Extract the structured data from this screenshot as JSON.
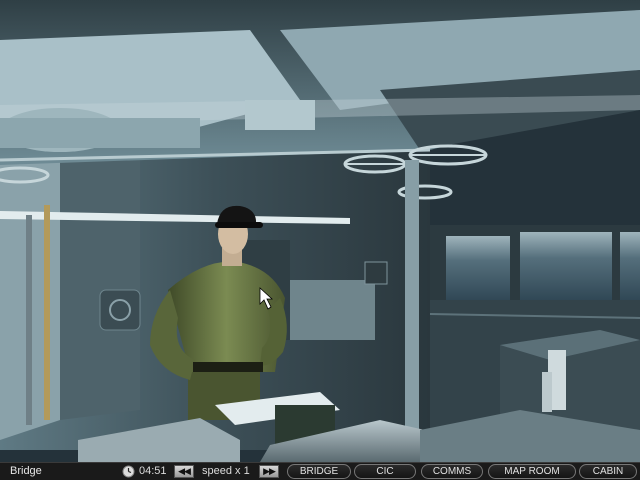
{
  "scene": {
    "location_name": "Bridge"
  },
  "statusbar": {
    "location": "Bridge",
    "time": "04:51",
    "speed_label": "speed x 1",
    "speed_down_icon": "rewind-icon",
    "speed_up_icon": "fast-forward-icon",
    "clock_icon": "clock-icon"
  },
  "nav": {
    "bridge": "BRIDGE",
    "cic": "CIC",
    "comms": "COMMS",
    "maproom": "MAP ROOM",
    "cabin": "CABIN"
  },
  "colors": {
    "bar_bg": "#1a1a1a",
    "uniform": "#6b7a45",
    "sea": "#3f5b6a",
    "hull": "#7f9aa5"
  }
}
